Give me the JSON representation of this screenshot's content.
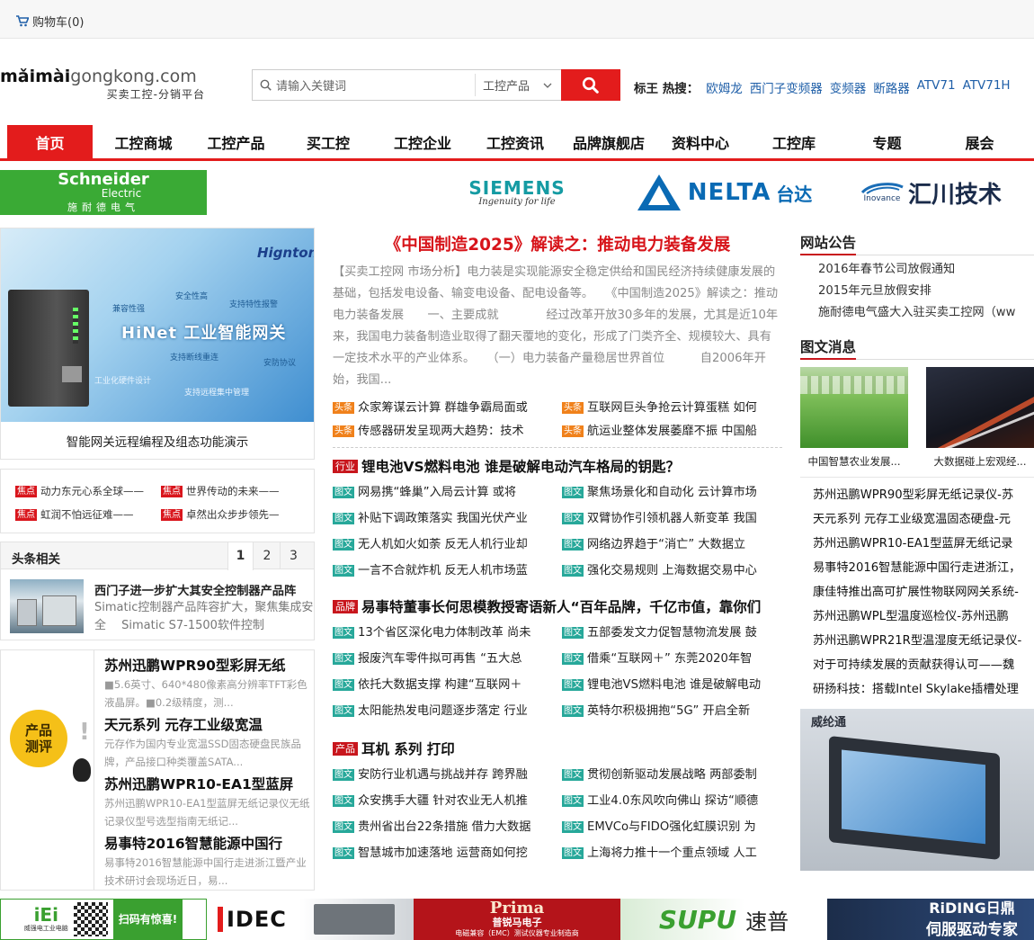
{
  "top": {
    "cart": "购物车(0)"
  },
  "logo": {
    "line1a": "mǎimài",
    "line1b": "gongkong",
    "line1c": ".com",
    "line2": "买卖工控-分销平台"
  },
  "search": {
    "placeholder": "请输入关键词",
    "category": "工控产品"
  },
  "hot": {
    "label": "标王 热搜：",
    "keywords": [
      "欧姆龙",
      "西门子变频器",
      "变频器",
      "断路器",
      "ATV71",
      "ATV71H"
    ]
  },
  "nav": [
    "首页",
    "工控商城",
    "工控产品",
    "买工控",
    "工控企业",
    "工控资讯",
    "品牌旗舰店",
    "资料中心",
    "工控库",
    "专题",
    "展会"
  ],
  "brands": {
    "schneider_1": "Schneider",
    "schneider_2": "Electric",
    "schneider_3": "施耐德电气",
    "siemens_1": "SIEMENS",
    "siemens_2": "Ingenuity for life",
    "delta_1": "NELTA",
    "delta_2": "台达",
    "inovance_1": "Inovance",
    "inovance_2": "汇川技术"
  },
  "banner": {
    "logo": "Hignton",
    "title": "HiNet 工业智能网关",
    "features": [
      "兼容性强",
      "安全性高",
      "支持特性报警",
      "支持断线重连",
      "安防协议",
      "工业化硬件设计",
      "支持远程集中管理"
    ],
    "caption": "智能网关远程编程及组态功能演示"
  },
  "focus": {
    "tag": "焦点",
    "items": [
      "动力东元心系全球——",
      "世界传动的未来——",
      "虹润不怕远征难——",
      "卓然出众步步领先—"
    ]
  },
  "headline": {
    "title": "头条相关",
    "pages": [
      "1",
      "2",
      "3"
    ],
    "news_title": "西门子进一步扩大其安全控制器产品阵",
    "news_body": "Simatic控制器产品阵容扩大，聚焦集成安全　 Simatic S7-1500软件控制"
  },
  "review": {
    "badge_1": "产品",
    "badge_2": "测评",
    "items": [
      {
        "title": "苏州迅鹏WPR90型彩屏无纸",
        "body": "■5.6英寸、640*480像素高分辨率TFT彩色液晶屏。■0.2级精度，测..."
      },
      {
        "title": "天元系列 元存工业级宽温",
        "body": "元存作为国内专业宽温SSD固态硬盘民族品牌，产品接口种类覆盖SATA..."
      },
      {
        "title": "苏州迅鹏WPR10-EA1型蓝屏",
        "body": "苏州迅鹏WPR10-EA1型蓝屏无纸记录仪无纸记录仪型号选型指南无纸记..."
      },
      {
        "title": "易事特2016智慧能源中国行",
        "body": "易事特2016智慧能源中国行走进浙江暨产业技术研讨会现场近日，易..."
      }
    ]
  },
  "main_article": {
    "title": "《中国制造2025》解读之：推动电力装备发展",
    "body": "【买卖工控网 市场分析】电力装是实现能源安全稳定供给和国民经济持续健康发展的基础，包括发电设备、输变电设备、配电设备等。　　《中国制造2025》解读之：推动电力装备发展　　一、主要成就　　　　经过改革开放30多年的发展，尤其是近10年来，我国电力装备制造业取得了翻天覆地的变化，形成了门类齐全、规模较大、具有一定技术水平的产业体系。　　（一）电力装备产量稳居世界首位　　　自2006年开始，我国..."
  },
  "toutiao": {
    "tag": "头条",
    "items": [
      "众家筹谋云计算 群雄争霸局面或",
      "互联网巨头争抢云计算蛋糕 如何",
      "传感器研发呈现两大趋势：技术",
      "航运业整体发展萎靡不振 中国船"
    ]
  },
  "sections": [
    {
      "tag": "行业",
      "title": "锂电池VS燃料电池 谁是破解电动汽车格局的钥匙？",
      "items": [
        "网易携“蜂巢”入局云计算 或将",
        "聚焦场景化和自动化 云计算市场",
        "补贴下调政策落实 我国光伏产业",
        "双臂协作引领机器人新变革 我国",
        "无人机如火如荼 反无人机行业却",
        "网络边界趋于“消亡” 大数据立",
        "一言不合就炸机 反无人机市场蓝",
        "强化交易规则 上海数据交易中心"
      ]
    },
    {
      "tag": "品牌",
      "title": "易事特董事长何思模教授寄语新人“百年品牌，千亿市值，靠你们",
      "items": [
        "13个省区深化电力体制改革 尚未",
        "五部委发文力促智慧物流发展 鼓",
        "报废汽车零件拟可再售 “五大总",
        "借乘“互联网＋” 东莞2020年智",
        "依托大数据支撑 构建“互联网＋",
        "锂电池VS燃料电池 谁是破解电动",
        "太阳能热发电问题逐步落定 行业",
        "英特尔积极拥抱“5G” 开启全新"
      ]
    },
    {
      "tag": "产品",
      "title": "耳机 系列 打印",
      "items": [
        "安防行业机遇与挑战并存 跨界融",
        "贯彻创新驱动发展战略 两部委制",
        "众安携手大疆 针对农业无人机推",
        "工业4.0东风吹向佛山 探访“顺德",
        "贵州省出台22条措施 借力大数据",
        "EMVCo与FIDO强化虹膜识别 为",
        "智慧城市加速落地 运营商如何挖",
        "上海将力推十一个重点领域 人工"
      ]
    }
  ],
  "tuwen_tag": "图文",
  "notice": {
    "title": "网站公告",
    "items": [
      "2016年春节公司放假通知",
      "2015年元旦放假安排",
      "施耐德电气盛大入驻买卖工控网（ww"
    ]
  },
  "picnews": {
    "title": "图文消息",
    "captions": [
      "中国智慧农业发展...",
      "大数据碰上宏观经..."
    ],
    "items": [
      "苏州迅鹏WPR90型彩屏无纸记录仪-苏",
      "天元系列 元存工业级宽温固态硬盘-元",
      "苏州迅鹏WPR10-EA1型蓝屏无纸记录",
      "易事特2016智慧能源中国行走进浙江，",
      "康佳特推出高可扩展性物联网网关系统-",
      "苏州迅鹏WPL型温度巡检仪-苏州迅鹏",
      "苏州迅鹏WPR21R型温湿度无纸记录仪-",
      "对于可持续发展的贡献获得认可——魏",
      "研扬科技：搭载Intel Skylake插槽处理"
    ]
  },
  "hmi": {
    "brand": "威纶通"
  },
  "ads": {
    "iei_1": "iEi",
    "iei_2": "威强电工业电脑",
    "iei_3": "扫码有惊喜!",
    "idec": "IDEC",
    "prima_1": "Prima",
    "prima_2": "普锐马电子",
    "prima_3": "电磁兼容（EMC）测试仪器专业制造商",
    "supu_1": "SUPU",
    "supu_2": "速普",
    "riding_1": "RiDING日鼎",
    "riding_2": "伺服驱动专家"
  }
}
